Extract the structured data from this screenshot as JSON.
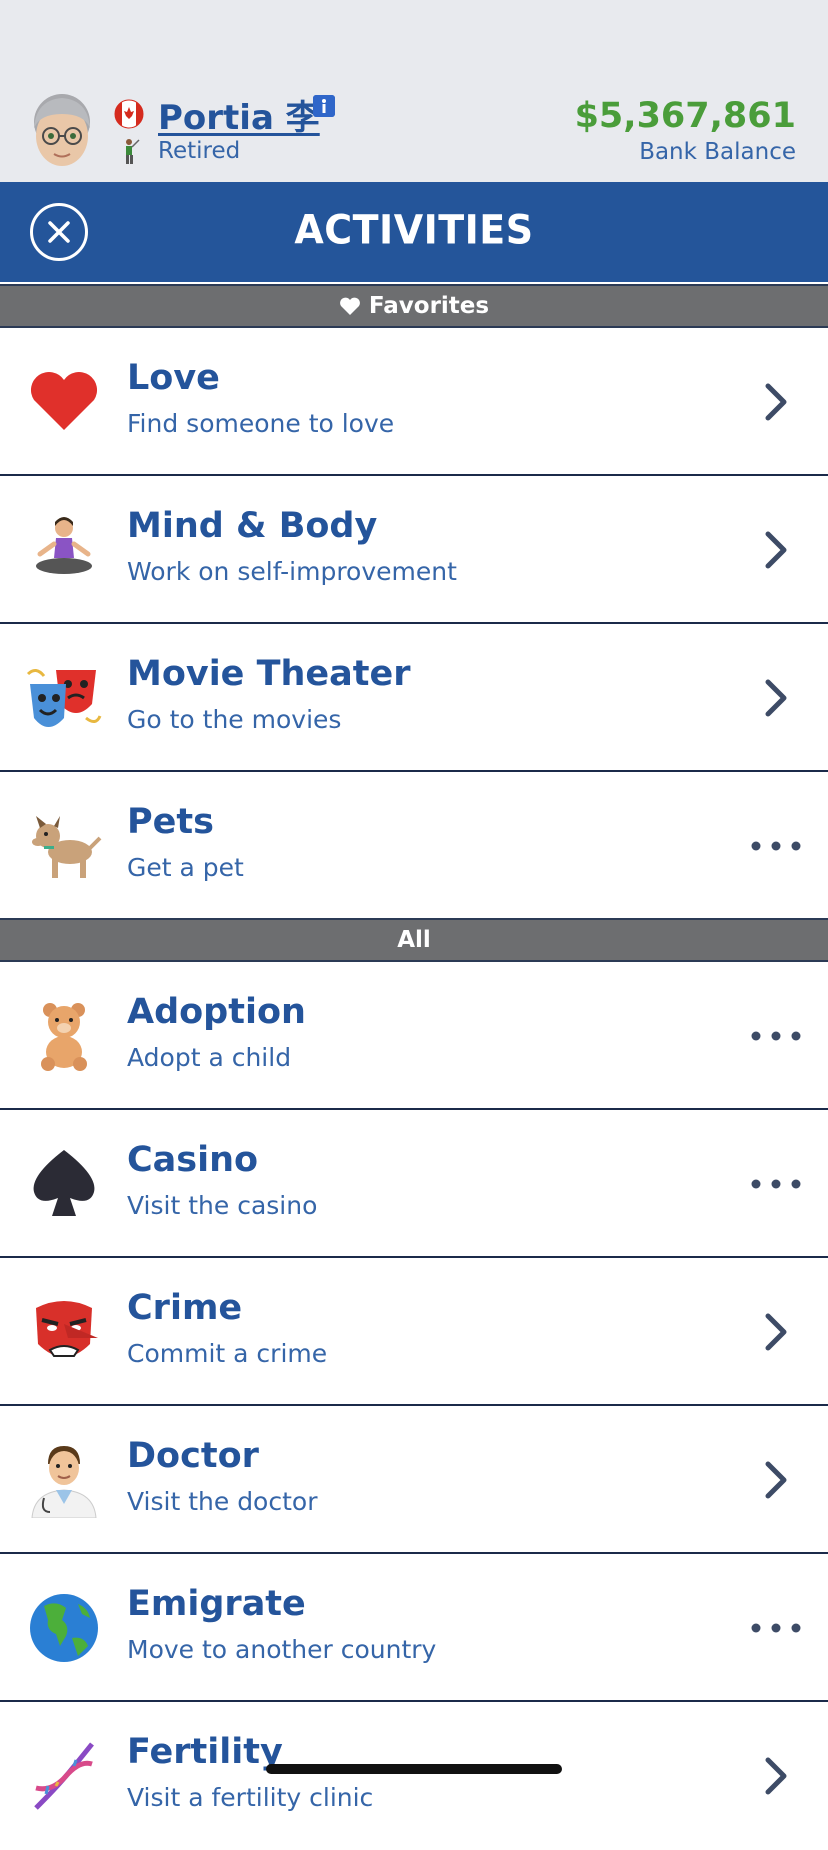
{
  "profile": {
    "name": "Portia 李",
    "occupation": "Retired",
    "balance": "$5,367,861",
    "balance_label": "Bank Balance",
    "avatar_icon": "elderly-woman-icon",
    "flag_icon": "canada-flag-icon",
    "status_icon": "golfer-icon"
  },
  "header": {
    "title": "ACTIVITIES",
    "close_icon": "close-icon"
  },
  "sections": {
    "favorites": "Favorites",
    "all": "All"
  },
  "favorites": [
    {
      "title": "Love",
      "subtitle": "Find someone to love",
      "icon": "heart-icon",
      "action": "chevron"
    },
    {
      "title": "Mind & Body",
      "subtitle": "Work on self-improvement",
      "icon": "meditation-icon",
      "action": "chevron"
    },
    {
      "title": "Movie Theater",
      "subtitle": "Go to the movies",
      "icon": "theater-masks-icon",
      "action": "chevron"
    },
    {
      "title": "Pets",
      "subtitle": "Get a pet",
      "icon": "dog-icon",
      "action": "more"
    }
  ],
  "all": [
    {
      "title": "Adoption",
      "subtitle": "Adopt a child",
      "icon": "teddy-bear-icon",
      "action": "more"
    },
    {
      "title": "Casino",
      "subtitle": "Visit the casino",
      "icon": "spade-icon",
      "action": "more"
    },
    {
      "title": "Crime",
      "subtitle": "Commit a crime",
      "icon": "goblin-mask-icon",
      "action": "chevron"
    },
    {
      "title": "Doctor",
      "subtitle": "Visit the doctor",
      "icon": "doctor-icon",
      "action": "chevron"
    },
    {
      "title": "Emigrate",
      "subtitle": "Move to another country",
      "icon": "globe-icon",
      "action": "more"
    },
    {
      "title": "Fertility",
      "subtitle": "Visit a fertility clinic",
      "icon": "dna-icon",
      "action": "chevron"
    }
  ],
  "colors": {
    "accent": "#24559a",
    "text": "#24549b",
    "balance": "#4a9d3a",
    "section_bar": "#6d6e70"
  }
}
